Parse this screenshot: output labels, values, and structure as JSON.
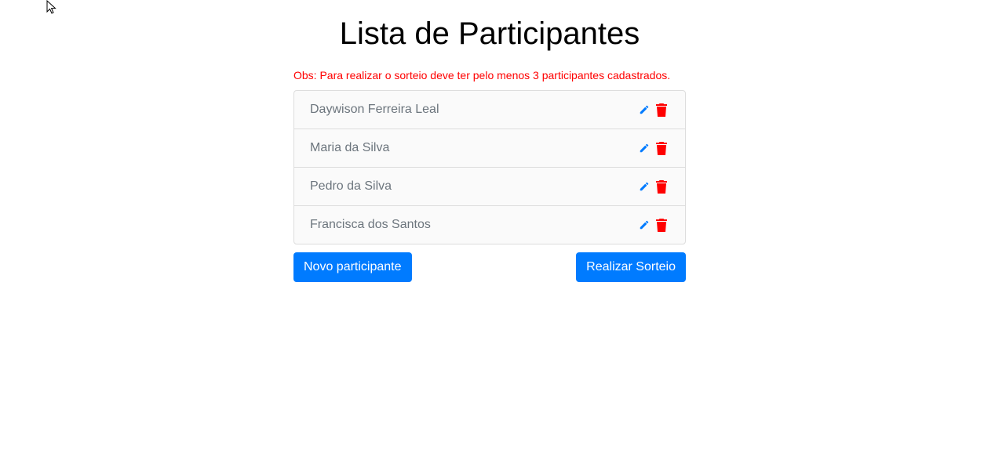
{
  "page": {
    "title": "Lista de Participantes",
    "note": "Obs: Para realizar o sorteio deve ter pelo menos 3 participantes cadastrados."
  },
  "participants": [
    {
      "name": "Daywison Ferreira Leal"
    },
    {
      "name": "Maria da Silva"
    },
    {
      "name": "Pedro da Silva"
    },
    {
      "name": "Francisca dos Santos"
    }
  ],
  "actions": {
    "new_participant_label": "Novo participante",
    "draw_label": "Realizar Sorteio"
  },
  "icons": {
    "edit": "pencil-icon",
    "delete": "trash-icon",
    "cursor": "mouse-pointer-icon"
  },
  "colors": {
    "primary": "#007bff",
    "danger": "#ff0000",
    "note": "#ff0000",
    "name_text": "#6c757d"
  }
}
